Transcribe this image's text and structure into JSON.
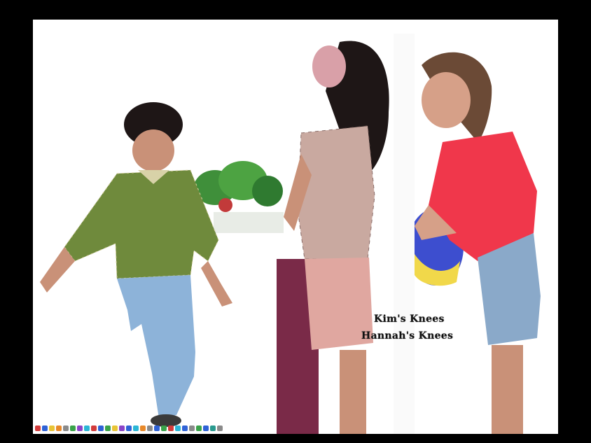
{
  "captions": {
    "line1": "Kim's Knees",
    "line2": "Hannah's Knees"
  },
  "colors": {
    "background": "#000000",
    "frame": "#ffffff",
    "boy_shirt": "#6f8a3c",
    "boy_jeans": "#8db3d9",
    "kim_shirt": "#c9a9a0",
    "kim_skirt": "#e0a7a0",
    "hannah_shirt": "#f0374b",
    "hannah_shorts": "#8aa9c9",
    "plants": "#3f8f3a",
    "skin": "#c99178",
    "hair": "#1e1616"
  },
  "taskbar": {
    "icons": [
      "red",
      "blue",
      "yellow",
      "orange",
      "gray",
      "green",
      "purple",
      "cyan",
      "red",
      "blue",
      "green",
      "yellow",
      "purple",
      "blue",
      "cyan",
      "orange",
      "gray",
      "blue",
      "green",
      "red",
      "cyan",
      "blue",
      "gray",
      "green",
      "blue",
      "teal",
      "gray"
    ]
  }
}
